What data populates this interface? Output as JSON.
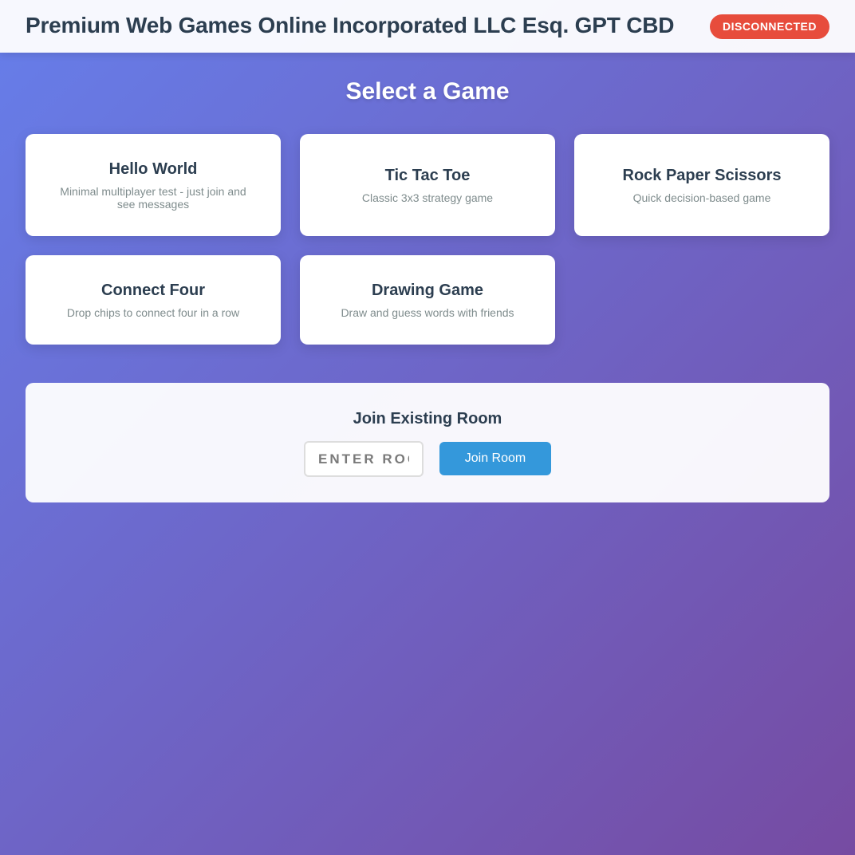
{
  "header": {
    "title": "Premium Web Games Online Incorporated LLC Esq. GPT CBD",
    "status": "DISCONNECTED",
    "status_color": "#e74c3c"
  },
  "main": {
    "section_title": "Select a Game",
    "games": [
      {
        "title": "Hello World",
        "description": "Minimal multiplayer test - just join and see messages"
      },
      {
        "title": "Tic Tac Toe",
        "description": "Classic 3x3 strategy game"
      },
      {
        "title": "Rock Paper Scissors",
        "description": "Quick decision-based game"
      },
      {
        "title": "Connect Four",
        "description": "Drop chips to connect four in a row"
      },
      {
        "title": "Drawing Game",
        "description": "Draw and guess words with friends"
      }
    ]
  },
  "join": {
    "title": "Join Existing Room",
    "input_placeholder": "ENTER ROOM CODE",
    "input_value": "",
    "button_label": "Join Room"
  },
  "colors": {
    "background_gradient": [
      "#667eea",
      "#764ba2"
    ],
    "accent": "#3498db",
    "text_dark": "#2c3e50",
    "text_muted": "#7f8c8d"
  }
}
